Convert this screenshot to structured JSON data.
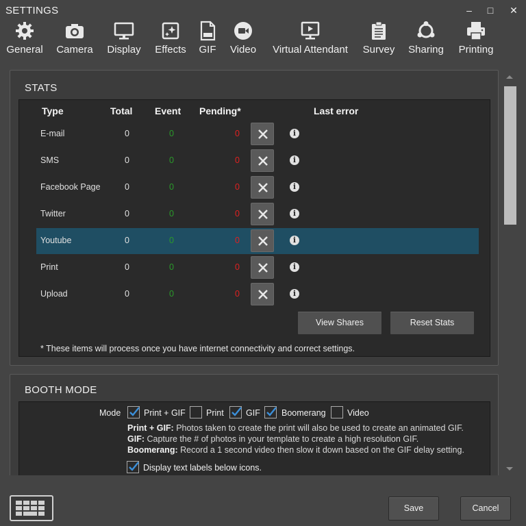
{
  "window": {
    "title": "SETTINGS",
    "minimize": "–",
    "maximize": "□",
    "close": "✕"
  },
  "toolbar": [
    {
      "label": "General",
      "icon": "gear-icon"
    },
    {
      "label": "Camera",
      "icon": "camera-icon"
    },
    {
      "label": "Display",
      "icon": "monitor-icon"
    },
    {
      "label": "Effects",
      "icon": "effects-icon"
    },
    {
      "label": "GIF",
      "icon": "gif-file-icon"
    },
    {
      "label": "Video",
      "icon": "video-camera-icon"
    },
    {
      "label": "Virtual Attendant",
      "icon": "presentation-screen-icon"
    },
    {
      "label": "Survey",
      "icon": "clipboard-icon"
    },
    {
      "label": "Sharing",
      "icon": "sharing-icon"
    },
    {
      "label": "Printing",
      "icon": "printer-icon"
    }
  ],
  "stats": {
    "title": "STATS",
    "columns": {
      "type": "Type",
      "total": "Total",
      "event": "Event",
      "pending": "Pending*",
      "last_error": "Last error"
    },
    "rows": [
      {
        "type": "E-mail",
        "total": "0",
        "event": "0",
        "pending": "0"
      },
      {
        "type": "SMS",
        "total": "0",
        "event": "0",
        "pending": "0"
      },
      {
        "type": "Facebook Page",
        "total": "0",
        "event": "0",
        "pending": "0"
      },
      {
        "type": "Twitter",
        "total": "0",
        "event": "0",
        "pending": "0"
      },
      {
        "type": "Youtube",
        "total": "0",
        "event": "0",
        "pending": "0"
      },
      {
        "type": "Print",
        "total": "0",
        "event": "0",
        "pending": "0"
      },
      {
        "type": "Upload",
        "total": "0",
        "event": "0",
        "pending": "0"
      }
    ],
    "view_shares": "View Shares",
    "reset_stats": "Reset Stats",
    "footnote": "* These items will process once you have internet connectivity and correct settings."
  },
  "booth": {
    "title": "BOOTH MODE",
    "mode_label": "Mode",
    "modes": [
      {
        "label": "Print + GIF",
        "checked": true
      },
      {
        "label": "Print",
        "checked": false
      },
      {
        "label": "GIF",
        "checked": true
      },
      {
        "label": "Boomerang",
        "checked": true
      },
      {
        "label": "Video",
        "checked": false
      }
    ],
    "desc1_b": "Print + GIF:",
    "desc1": " Photos taken to create the print will also be used to create an animated GIF.",
    "desc2_b": "GIF:",
    "desc2": " Capture the # of photos in your template to create a high resolution GIF.",
    "desc3_b": "Boomerang:",
    "desc3": " Record a 1 second video then slow it down based on the GIF delay setting.",
    "display_labels": "Display text labels below icons.",
    "display_labels_checked": true
  },
  "footer": {
    "save": "Save",
    "cancel": "Cancel"
  },
  "colors": {
    "selected_row": "#1f4e63",
    "event_value": "#2a9a2a",
    "pending_value": "#e02020"
  }
}
